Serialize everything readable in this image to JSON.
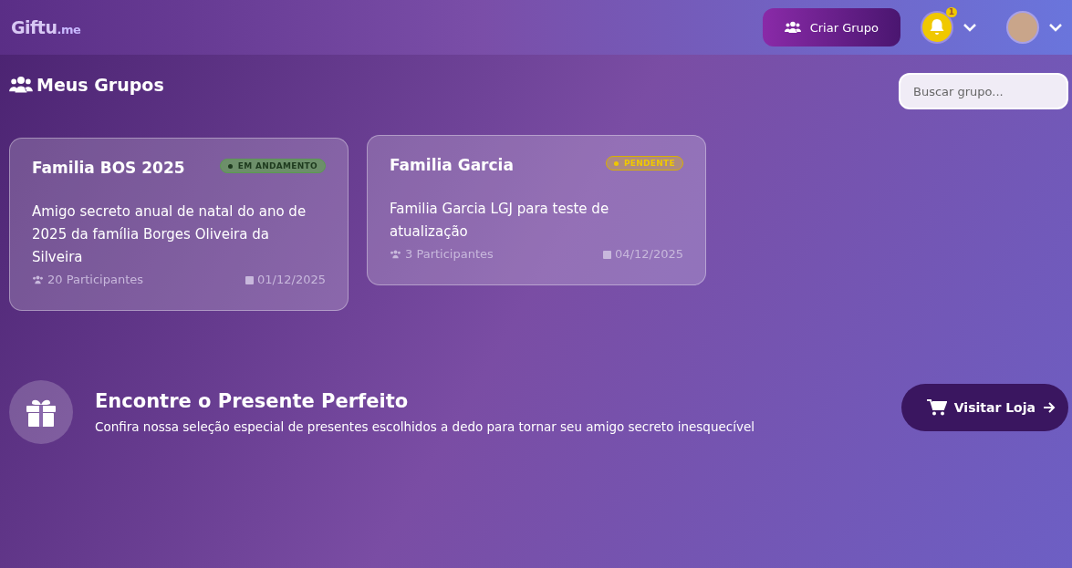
{
  "header": {
    "logo": {
      "main": "Giftu",
      "suffix": ".me"
    },
    "create_button": "Criar Grupo",
    "notifications": {
      "count": "1"
    }
  },
  "groups_section": {
    "title": "Meus Grupos",
    "search": {
      "placeholder": "Buscar grupo..."
    },
    "groups": [
      {
        "name": "Familia BOS 2025",
        "status": {
          "label": "EM ANDAMENTO",
          "kind": "active"
        },
        "description": "Amigo secreto anual de natal do ano de 2025 da família Borges Oliveira da Silveira",
        "participants": "20 Participantes",
        "date": "01/12/2025"
      },
      {
        "name": "Familia Garcia",
        "status": {
          "label": "PENDENTE",
          "kind": "pending"
        },
        "description": "Familia Garcia LGJ para teste de atualização",
        "participants": "3 Participantes",
        "date": "04/12/2025"
      }
    ]
  },
  "promo": {
    "title": "Encontre o Presente Perfeito",
    "text": "Confira nossa seleção especial de presentes escolhidos a dedo para tornar seu amigo secreto inesquecível",
    "button": "Visitar Loja"
  }
}
